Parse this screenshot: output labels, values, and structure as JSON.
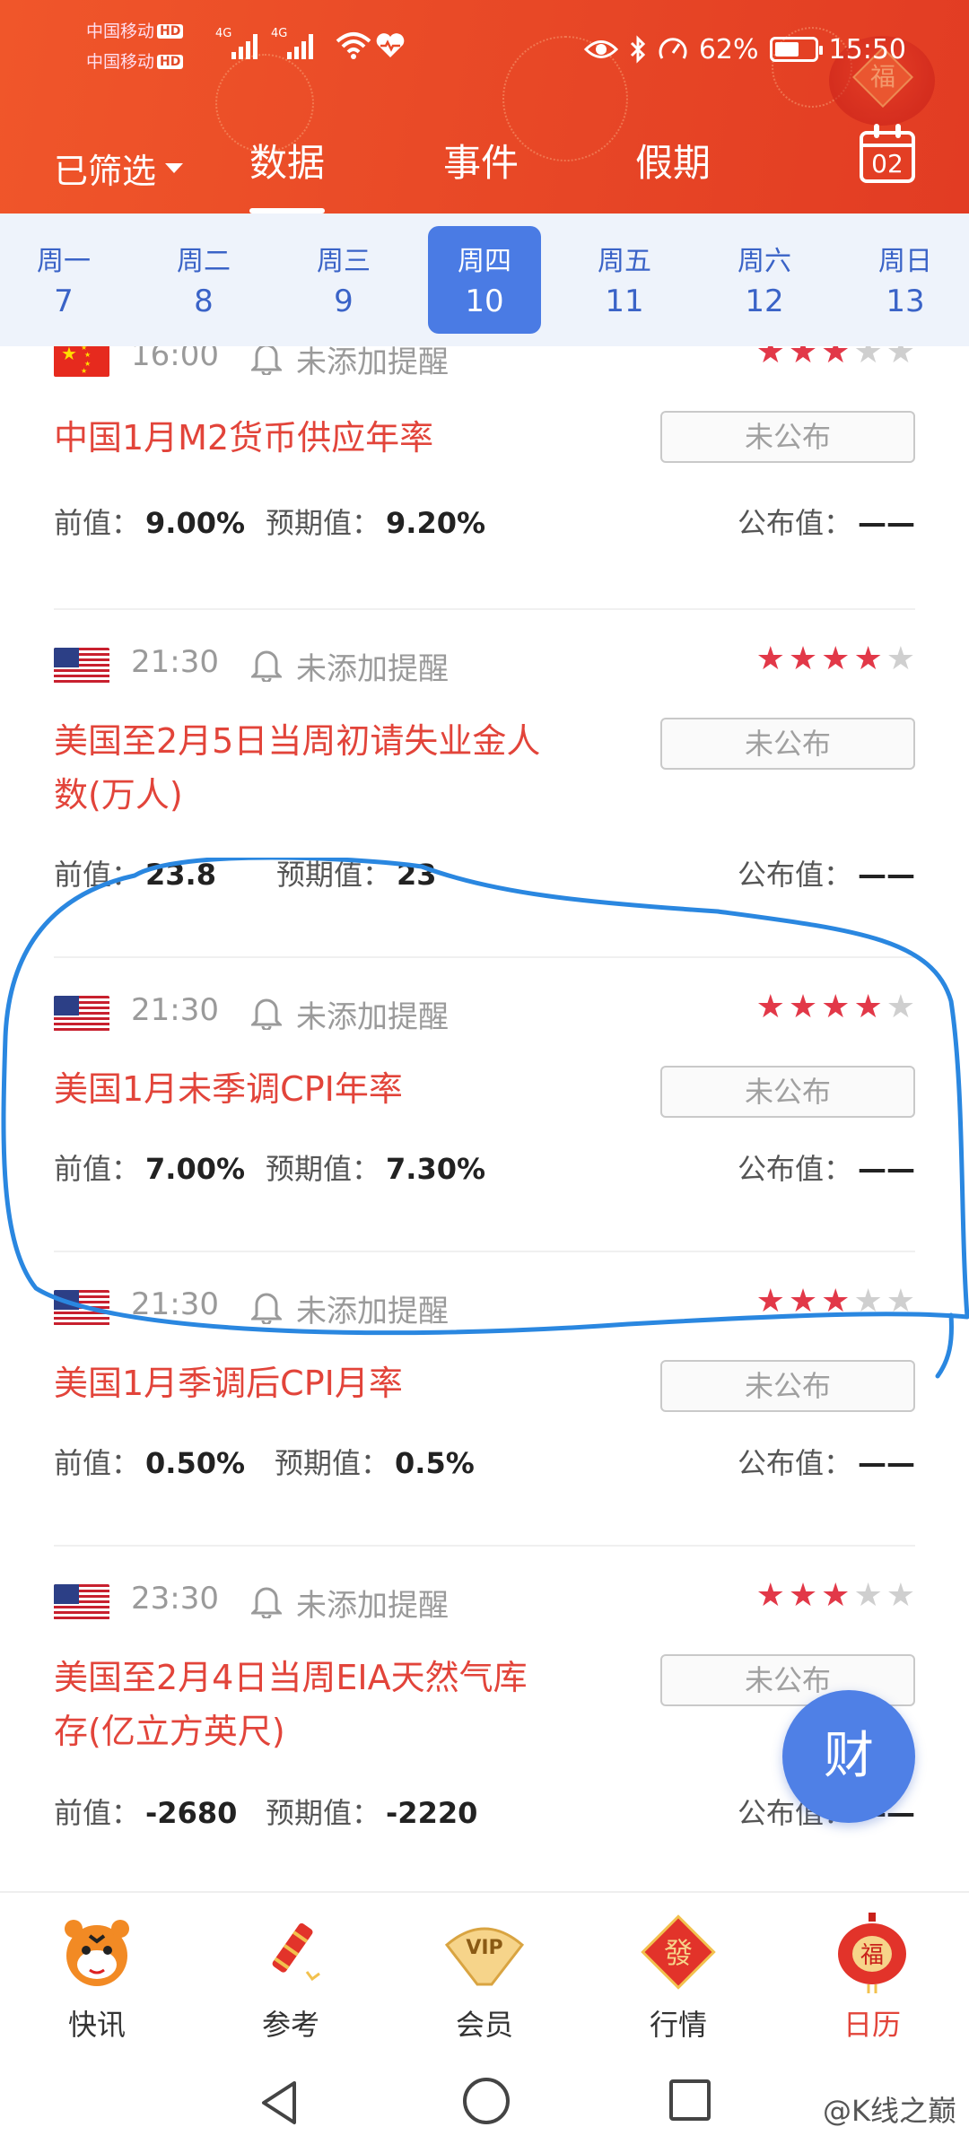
{
  "status_bar": {
    "carrier1": "中国移动",
    "carrier2": "中国移动",
    "hd": "HD",
    "net": "4G",
    "battery": "62%",
    "battery_level": 0.62,
    "time": "15:50"
  },
  "header": {
    "filter_label": "已筛选",
    "tabs": [
      {
        "label": "数据",
        "active": true
      },
      {
        "label": "事件",
        "active": false
      },
      {
        "label": "假期",
        "active": false
      }
    ],
    "calendar_day": "02",
    "fu_char": "福"
  },
  "week": [
    {
      "name": "周一",
      "date": "7",
      "active": false
    },
    {
      "name": "周二",
      "date": "8",
      "active": false
    },
    {
      "name": "周三",
      "date": "9",
      "active": false
    },
    {
      "name": "周四",
      "date": "10",
      "active": true
    },
    {
      "name": "周五",
      "date": "11",
      "active": false
    },
    {
      "name": "周六",
      "date": "12",
      "active": false
    },
    {
      "name": "周日",
      "date": "13",
      "active": false
    }
  ],
  "labels": {
    "remind": "未添加提醒",
    "publish_button": "未公布",
    "prev": "前值：",
    "expected": "预期值：",
    "actual": "公布值："
  },
  "events": [
    {
      "country": "cn",
      "time": "16:00",
      "stars": 3,
      "title_lines": [
        "中国1月M2货币供应年率"
      ],
      "prev": "9.00%",
      "expected": "9.20%",
      "actual": "——"
    },
    {
      "country": "us",
      "time": "21:30",
      "stars": 4,
      "title_lines": [
        "美国至2月5日当周初请失业金人",
        "数(万人)"
      ],
      "prev": "23.8",
      "expected": "23",
      "actual": "——"
    },
    {
      "country": "us",
      "time": "21:30",
      "stars": 4,
      "title_lines": [
        "美国1月未季调CPI年率"
      ],
      "prev": "7.00%",
      "expected": "7.30%",
      "actual": "——"
    },
    {
      "country": "us",
      "time": "21:30",
      "stars": 3,
      "title_lines": [
        "美国1月季调后CPI月率"
      ],
      "prev": "0.50%",
      "expected": "0.5%",
      "actual": "——"
    },
    {
      "country": "us",
      "time": "23:30",
      "stars": 3,
      "title_lines": [
        "美国至2月4日当周EIA天然气库",
        "存(亿立方英尺)"
      ],
      "prev": "-2680",
      "expected": "-2220",
      "actual": "——"
    }
  ],
  "fab_label": "财",
  "tabbar": [
    {
      "label": "快讯",
      "icon": "tiger-icon",
      "active": false
    },
    {
      "label": "参考",
      "icon": "firecracker-icon",
      "active": false
    },
    {
      "label": "会员",
      "icon": "vip-fan-icon",
      "active": false
    },
    {
      "label": "行情",
      "icon": "fa-diamond-icon",
      "active": false
    },
    {
      "label": "日历",
      "icon": "fu-lantern-icon",
      "active": true
    }
  ],
  "tabbar_glyphs": {
    "vip": "VIP",
    "fa": "發",
    "fu": "福"
  },
  "watermark": "@K线之巅",
  "colors": {
    "header": "#e94a27",
    "accent_blue": "#4a7be4",
    "title_red": "#e2443a",
    "star_red": "#e23848",
    "annotation_blue": "#2a87e0"
  }
}
